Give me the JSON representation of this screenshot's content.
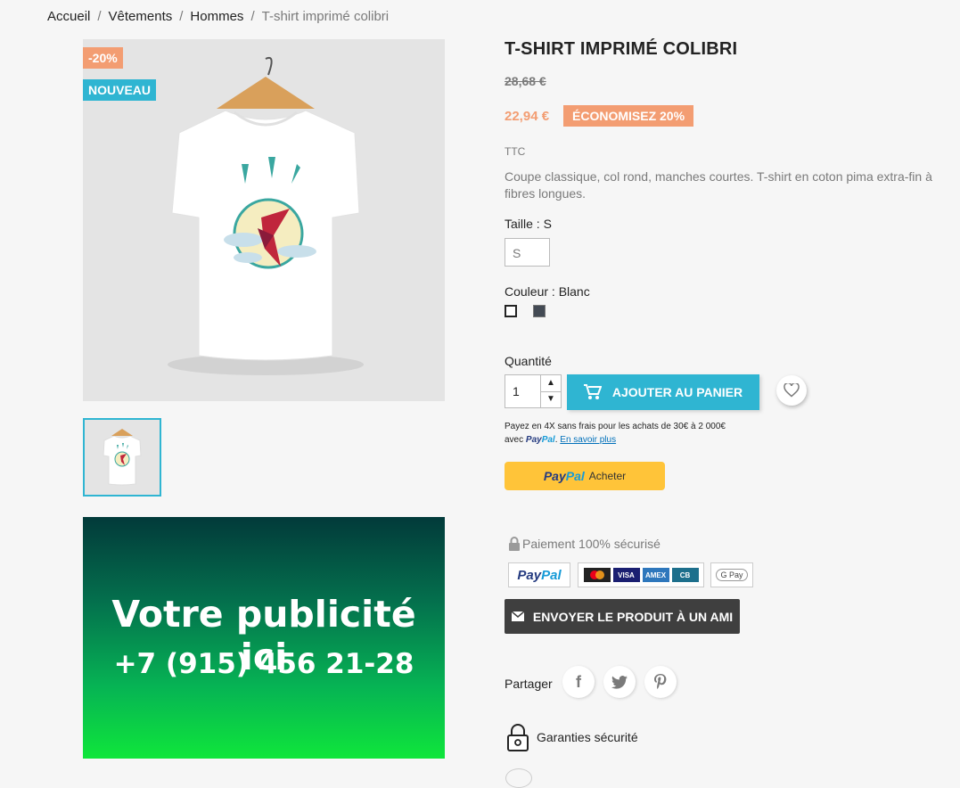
{
  "breadcrumb": {
    "items": [
      "Accueil",
      "Vêtements",
      "Hommes"
    ],
    "current": "T-shirt imprimé colibri",
    "separator": "/"
  },
  "product": {
    "flags": {
      "discount": "-20%",
      "new": "NOUVEAU"
    },
    "title": "T-SHIRT IMPRIMÉ COLIBRI",
    "old_price": "28,68 €",
    "price": "22,94 €",
    "savings": "ÉCONOMISEZ 20%",
    "tax_label": "TTC",
    "description": "Coupe classique, col rond, manches courtes. T-shirt en coton pima extra-fin à fibres longues.",
    "size_label": "Taille : S",
    "size_value": "S",
    "color_label": "Couleur : Blanc",
    "colors": [
      "#ffffff",
      "#434a54"
    ],
    "quantity_label": "Quantité",
    "quantity": "1",
    "add_to_cart": "AJOUTER AU PANIER"
  },
  "paypal": {
    "pay4x_line1": "Payez en 4X sans frais pour les achats de 30€ à 2 000€",
    "pay4x_prefix": "avec",
    "pay4x_logo_a": "Pay",
    "pay4x_logo_b": "Pal",
    "pay4x_link": "En savoir plus",
    "button_logo_a": "Pay",
    "button_logo_b": "Pal",
    "button_text": "Acheter"
  },
  "ad": {
    "title": "Votre publicité ici",
    "phone": "+7 (915) 456 21-28"
  },
  "payment": {
    "secure_label": "Paiement 100% sécurisé",
    "paypal_a": "Pay",
    "paypal_b": "Pal",
    "cards": [
      "mastercard",
      "VISA",
      "AMEX",
      "CB"
    ],
    "gpay": "G Pay"
  },
  "send_friend": "ENVOYER LE PRODUIT À UN AMI",
  "share": {
    "label": "Partager",
    "icons": [
      "facebook-icon",
      "twitter-icon",
      "pinterest-icon"
    ]
  },
  "guarantee": "Garanties sécurité",
  "colors": {
    "accent": "#2fb5d2",
    "discount": "#f39d72",
    "dark": "#3f3f3f",
    "paypal_yellow": "#ffc439"
  }
}
